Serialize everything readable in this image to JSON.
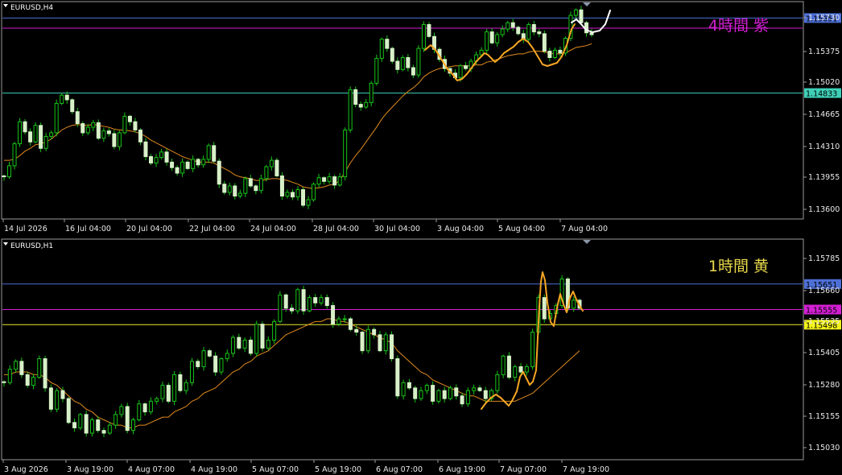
{
  "charts": [
    {
      "type": "candlestick",
      "symbol_label": "EURUSD,H4",
      "annotation": "4時間 紫",
      "annotation_color": "#d21fd2",
      "price_range": [
        1.1346,
        1.1583
      ],
      "y_ticks": [
        "1.15730",
        "1.15375",
        "1.15020",
        "1.14665",
        "1.14310",
        "1.13955",
        "1.13600"
      ],
      "x_ticks": [
        "14 Jul 2026",
        "16 Jul 04:00",
        "20 Jul 04:00",
        "22 Jul 04:00",
        "24 Jul 04:00",
        "28 Jul 04:00",
        "30 Jul 04:00",
        "3 Aug 04:00",
        "5 Aug 04:00",
        "7 Aug 04:00"
      ],
      "hlines": [
        {
          "price": 1.15651,
          "color": "#4d6fd6",
          "label": "1.15651",
          "tag_bg": "#4d6fd6"
        },
        {
          "price": 1.1554,
          "color": "#d21fd2"
        },
        {
          "price": 1.14833,
          "color": "#3fd0b8",
          "label": "1.14833",
          "tag_bg": "#3fd0b8"
        }
      ],
      "close": [
        1.1392,
        1.1404,
        1.1428,
        1.1452,
        1.1441,
        1.143,
        1.1448,
        1.1423,
        1.1436,
        1.144,
        1.1472,
        1.1481,
        1.1476,
        1.1463,
        1.145,
        1.144,
        1.1446,
        1.1451,
        1.1434,
        1.1442,
        1.1439,
        1.1425,
        1.144,
        1.1458,
        1.1452,
        1.1443,
        1.143,
        1.1414,
        1.1407,
        1.1413,
        1.1419,
        1.1408,
        1.1402,
        1.1396,
        1.1408,
        1.1401,
        1.1411,
        1.1405,
        1.1411,
        1.1426,
        1.1409,
        1.1384,
        1.1375,
        1.1382,
        1.1371,
        1.1374,
        1.139,
        1.1382,
        1.1377,
        1.139,
        1.1403,
        1.141,
        1.1393,
        1.1371,
        1.1375,
        1.137,
        1.1378,
        1.1361,
        1.1367,
        1.1384,
        1.1391,
        1.1387,
        1.1392,
        1.1383,
        1.1392,
        1.1443,
        1.1487,
        1.1471,
        1.1468,
        1.1473,
        1.1494,
        1.1521,
        1.1542,
        1.1532,
        1.1518,
        1.1509,
        1.1522,
        1.1511,
        1.1503,
        1.1532,
        1.1558,
        1.1545,
        1.1531,
        1.152,
        1.151,
        1.1505,
        1.15,
        1.1513,
        1.151,
        1.1518,
        1.1525,
        1.153,
        1.155,
        1.1538,
        1.1547,
        1.1553,
        1.156,
        1.1555,
        1.1548,
        1.1542,
        1.1558,
        1.155,
        1.1548,
        1.1529,
        1.1522,
        1.153,
        1.1527,
        1.1543,
        1.1568,
        1.1574,
        1.156,
        1.1549,
        1.1547
      ],
      "ma": [
        1.141,
        1.141,
        1.1411,
        1.1415,
        1.142,
        1.1423,
        1.1427,
        1.1428,
        1.143,
        1.1433,
        1.1438,
        1.1443,
        1.1446,
        1.1448,
        1.1449,
        1.1448,
        1.1448,
        1.1449,
        1.1448,
        1.1447,
        1.1446,
        1.1444,
        1.1443,
        1.1443,
        1.1442,
        1.1441,
        1.1439,
        1.1436,
        1.1432,
        1.1429,
        1.1426,
        1.1423,
        1.142,
        1.1417,
        1.1414,
        1.1412,
        1.141,
        1.1408,
        1.1408,
        1.1408,
        1.1407,
        1.1404,
        1.1401,
        1.1398,
        1.1394,
        1.1392,
        1.1391,
        1.139,
        1.1388,
        1.1388,
        1.1389,
        1.139,
        1.139,
        1.1389,
        1.1388,
        1.1386,
        1.1384,
        1.1381,
        1.138,
        1.1379,
        1.138,
        1.1381,
        1.1383,
        1.1384,
        1.1388,
        1.1397,
        1.1407,
        1.1415,
        1.1422,
        1.143,
        1.1438,
        1.1446,
        1.1455,
        1.1462,
        1.1468,
        1.1474,
        1.148,
        1.1485,
        1.1489,
        1.1494,
        1.1501,
        1.1505,
        1.1508,
        1.151,
        1.1511,
        1.1512,
        1.1513,
        1.1513,
        1.1513,
        1.1513,
        1.1514,
        1.1514,
        1.1517,
        1.1518,
        1.152,
        1.1522,
        1.1524,
        1.1525,
        1.1526,
        1.1526,
        1.1528,
        1.1529,
        1.1529,
        1.1528,
        1.1527,
        1.1526,
        1.1526,
        1.1527,
        1.153,
        1.1533,
        1.1534,
        1.1535,
        1.1537
      ]
    },
    {
      "type": "candlestick",
      "symbol_label": "EURUSD,H1",
      "annotation": "1時間 黄",
      "annotation_color": "#e8d84a",
      "price_range": [
        1.1499,
        1.1582
      ],
      "y_ticks": [
        "1.15785",
        "1.15660",
        "1.15535",
        "1.15405",
        "1.15280",
        "1.15155",
        "1.15030"
      ],
      "x_ticks": [
        "3 Aug 2026",
        "3 Aug 19:00",
        "4 Aug 07:00",
        "4 Aug 19:00",
        "5 Aug 07:00",
        "5 Aug 19:00",
        "6 Aug 07:00",
        "6 Aug 19:00",
        "7 Aug 07:00",
        "7 Aug 19:00"
      ],
      "hlines": [
        {
          "price": 1.15651,
          "color": "#4d6fd6",
          "label": "1.15651",
          "tag_bg": "#4d6fd6"
        },
        {
          "price": 1.15555,
          "color": "#d21fd2",
          "label": "1.15555",
          "tag_bg": "#d21fd2"
        },
        {
          "price": 1.15498,
          "color": "#e8e832",
          "label": "1.15498",
          "tag_bg": "#f2f21a"
        }
      ],
      "close": [
        1.1528,
        1.1533,
        1.1536,
        1.1531,
        1.1527,
        1.153,
        1.1537,
        1.1526,
        1.1518,
        1.1525,
        1.1522,
        1.1513,
        1.1511,
        1.1516,
        1.1509,
        1.1514,
        1.151,
        1.1509,
        1.1512,
        1.1516,
        1.1519,
        1.151,
        1.1514,
        1.152,
        1.1517,
        1.1521,
        1.1522,
        1.1527,
        1.1521,
        1.1531,
        1.1525,
        1.1528,
        1.1536,
        1.1534,
        1.154,
        1.1538,
        1.1532,
        1.1537,
        1.1539,
        1.1545,
        1.1541,
        1.1544,
        1.1539,
        1.155,
        1.1541,
        1.1544,
        1.1551,
        1.1561,
        1.1556,
        1.1555,
        1.1563,
        1.1555,
        1.156,
        1.1558,
        1.156,
        1.1557,
        1.155,
        1.1552,
        1.1552,
        1.1548,
        1.1547,
        1.154,
        1.1548,
        1.1546,
        1.154,
        1.1546,
        1.1537,
        1.1523,
        1.1528,
        1.1526,
        1.1522,
        1.1525,
        1.1527,
        1.1521,
        1.1525,
        1.1522,
        1.1526,
        1.1523,
        1.152,
        1.1525,
        1.1526,
        1.1525,
        1.1522,
        1.1525,
        1.1531,
        1.1538,
        1.153,
        1.1534,
        1.1532,
        1.1534,
        1.1547,
        1.156,
        1.1552,
        1.1554,
        1.1557,
        1.1567,
        1.1556,
        1.1559,
        1.1556
      ],
      "ma": [
        1.1531,
        1.1531,
        1.1532,
        1.1532,
        1.1532,
        1.1531,
        1.1531,
        1.153,
        1.1528,
        1.1527,
        1.1525,
        1.1523,
        1.1521,
        1.152,
        1.1518,
        1.1517,
        1.1515,
        1.1514,
        1.1513,
        1.1512,
        1.1512,
        1.1511,
        1.1511,
        1.1512,
        1.1512,
        1.1513,
        1.1514,
        1.1515,
        1.1515,
        1.1517,
        1.1518,
        1.1519,
        1.1521,
        1.1522,
        1.1524,
        1.1525,
        1.1526,
        1.1528,
        1.153,
        1.1532,
        1.1533,
        1.1535,
        1.1536,
        1.1538,
        1.1539,
        1.154,
        1.1542,
        1.1544,
        1.1546,
        1.1547,
        1.1548,
        1.1549,
        1.155,
        1.1551,
        1.1551,
        1.1552,
        1.1552,
        1.1551,
        1.1551,
        1.155,
        1.1549,
        1.1548,
        1.1547,
        1.1546,
        1.1545,
        1.1544,
        1.1543,
        1.154,
        1.1538,
        1.1536,
        1.1534,
        1.1532,
        1.1531,
        1.1529,
        1.1528,
        1.1527,
        1.1526,
        1.1525,
        1.1524,
        1.1523,
        1.1523,
        1.1522,
        1.1521,
        1.1521,
        1.1521,
        1.1521,
        1.1521,
        1.1521,
        1.1522,
        1.1523,
        1.1524,
        1.1526,
        1.1528,
        1.153,
        1.1532,
        1.1534,
        1.1536,
        1.1538,
        1.154
      ]
    }
  ]
}
